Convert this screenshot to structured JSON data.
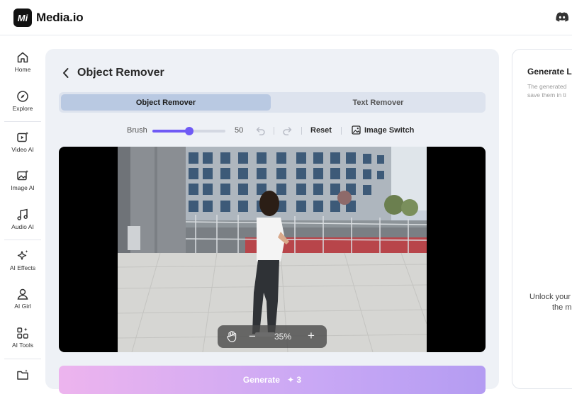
{
  "app": {
    "logo_mark": "Mi",
    "name": "Media.io"
  },
  "header": {
    "discord_icon": "discord-icon"
  },
  "sidebar": {
    "items": [
      {
        "label": "Home",
        "icon": "home-icon"
      },
      {
        "label": "Explore",
        "icon": "compass-icon"
      },
      {
        "label": "Video AI",
        "icon": "video-ai-icon"
      },
      {
        "label": "Image AI",
        "icon": "image-ai-icon"
      },
      {
        "label": "Audio AI",
        "icon": "music-note-icon"
      },
      {
        "label": "AI Effects",
        "icon": "sparkle-icon"
      },
      {
        "label": "AI Girl",
        "icon": "ai-girl-icon"
      },
      {
        "label": "AI Tools",
        "icon": "tools-grid-icon"
      },
      {
        "label": "",
        "icon": "folder-icon"
      }
    ]
  },
  "editor": {
    "title": "Object Remover",
    "tabs": [
      {
        "label": "Object Remover",
        "active": true
      },
      {
        "label": "Text Remover",
        "active": false
      }
    ],
    "toolbar": {
      "brush_label": "Brush",
      "brush_value": "50",
      "brush_fraction": 0.5,
      "reset_label": "Reset",
      "image_switch_label": "Image Switch"
    },
    "zoom": {
      "percent": "35%"
    },
    "generate": {
      "label": "Generate",
      "credits": "3"
    }
  },
  "right_panel": {
    "title": "Generate L",
    "desc_line1": "The generated",
    "desc_line2": "save them in ti",
    "unlock_line1": "Unlock your",
    "unlock_line2": "the m"
  },
  "colors": {
    "accent": "#6f5af5",
    "panel_bg": "#eef1f6",
    "tab_active": "#b9c9e2",
    "generate_gradient_start": "#edb4ee",
    "generate_gradient_end": "#b49cf2"
  }
}
